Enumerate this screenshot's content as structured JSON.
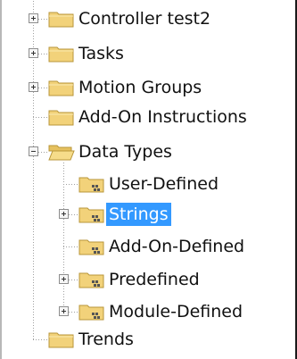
{
  "tree": {
    "items": [
      {
        "label": "Controller test2",
        "icon": "folder-icon",
        "expander": "plus"
      },
      {
        "label": "Tasks",
        "icon": "folder-icon",
        "expander": "plus"
      },
      {
        "label": "Motion Groups",
        "icon": "folder-icon",
        "expander": "plus"
      },
      {
        "label": "Add-On Instructions",
        "icon": "folder-icon",
        "expander": "none"
      },
      {
        "label": "Data Types",
        "icon": "folder-open-icon",
        "expander": "minus"
      },
      {
        "label": "User-Defined",
        "icon": "data-type-folder-icon",
        "expander": "none"
      },
      {
        "label": "Strings",
        "icon": "data-type-folder-icon",
        "expander": "plus",
        "selected": true
      },
      {
        "label": "Add-On-Defined",
        "icon": "data-type-folder-icon",
        "expander": "none"
      },
      {
        "label": "Predefined",
        "icon": "data-type-folder-icon",
        "expander": "plus"
      },
      {
        "label": "Module-Defined",
        "icon": "data-type-folder-icon",
        "expander": "plus"
      },
      {
        "label": "Trends",
        "icon": "folder-icon",
        "expander": "none"
      }
    ]
  },
  "colors": {
    "selection": "#3399ff",
    "folder": "#f2d27a",
    "tree_line": "#a0a0a0"
  }
}
